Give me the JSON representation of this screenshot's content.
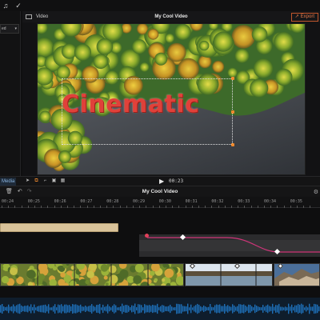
{
  "topbar": {
    "icons": [
      "music-icon",
      "check-circle-icon"
    ],
    "music_glyph": "♫",
    "check_glyph": "✓"
  },
  "left_panel": {
    "select_value": "ed",
    "select_chevron": "▾"
  },
  "viewer": {
    "tab_label": "Video",
    "project_title": "My Cool Video",
    "export_label": "Export",
    "export_icon": "↗",
    "overlay_text": "Cinematic"
  },
  "transport": {
    "media_tab": "Media",
    "timecode": "00:23",
    "play_glyph": "▶",
    "tools": [
      "pointer-icon",
      "transform-icon",
      "crop-icon",
      "snap-icon",
      "grid-icon"
    ],
    "tool_glyphs": [
      "➤",
      "⧉",
      "⌐",
      "▣",
      "▦"
    ]
  },
  "timeline": {
    "title": "My Cool Video",
    "tool_glyphs": [
      "🗑",
      "↶",
      "↷"
    ],
    "gear_glyph": "⚙",
    "ruler_ticks": [
      "00:24",
      "00:25",
      "00:26",
      "00:27",
      "00:28",
      "00:29",
      "00:30",
      "00:31",
      "00:32",
      "00:33",
      "00:34",
      "00:35"
    ]
  },
  "colors": {
    "accent": "#f08a2e",
    "title_clip": "#d9c39a",
    "keyframe_curve": "#d0357a",
    "audio": "#1e6fb8",
    "overlay_text": "#e0413a"
  }
}
